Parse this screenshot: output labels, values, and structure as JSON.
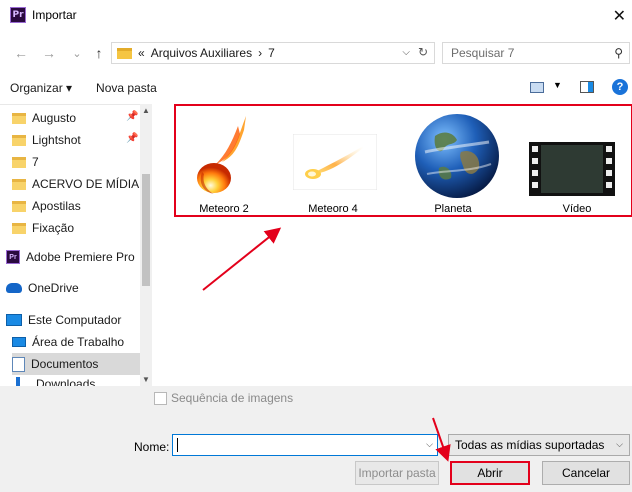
{
  "window": {
    "title": "Importar",
    "app_badge": "Pr",
    "close_glyph": "✕"
  },
  "address": {
    "back_glyph": "←",
    "forward_glyph": "→",
    "up_glyph": "↑",
    "path_prefix": "«",
    "crumbs": [
      "Arquivos Auxiliares",
      "›",
      "7"
    ],
    "search_placeholder": "Pesquisar 7"
  },
  "toolbar": {
    "organize": "Organizar ▾",
    "new_folder": "Nova pasta",
    "help_glyph": "?"
  },
  "sidebar": {
    "items": [
      {
        "label": "Augusto",
        "icon": "folder-icon",
        "pinned": true
      },
      {
        "label": "Lightshot",
        "icon": "folder-icon",
        "pinned": true
      },
      {
        "label": "7",
        "icon": "folder-icon"
      },
      {
        "label": "ACERVO DE MÍDIA",
        "icon": "folder-icon"
      },
      {
        "label": "Apostilas",
        "icon": "folder-icon"
      },
      {
        "label": "Fixação",
        "icon": "folder-icon"
      },
      {
        "label": "Adobe Premiere Pro",
        "icon": "premiere-icon"
      },
      {
        "label": "OneDrive",
        "icon": "cloud-icon"
      },
      {
        "label": "Este Computador",
        "icon": "computer-icon"
      },
      {
        "label": "Área de Trabalho",
        "icon": "desktop-icon"
      },
      {
        "label": "Documentos",
        "icon": "documents-icon",
        "selected": true
      },
      {
        "label": "Downloads",
        "icon": "downloads-icon"
      }
    ]
  },
  "files": [
    {
      "name": "Meteoro 2",
      "icon": "fireball-thumbnail"
    },
    {
      "name": "Meteoro 4",
      "icon": "meteor-thumbnail"
    },
    {
      "name": "Planeta",
      "icon": "earth-thumbnail"
    },
    {
      "name": "Vídeo",
      "icon": "film-thumbnail"
    }
  ],
  "sequence_checkbox": {
    "label": "Sequência de imagens",
    "checked": false
  },
  "filename": {
    "label": "Nome:",
    "value": ""
  },
  "filetype": {
    "selected": "Todas as mídias suportadas"
  },
  "buttons": {
    "import_folder": "Importar pasta",
    "open": "Abrir",
    "cancel": "Cancelar"
  },
  "colors": {
    "highlight": "#e3001b",
    "accent": "#0078d7"
  }
}
